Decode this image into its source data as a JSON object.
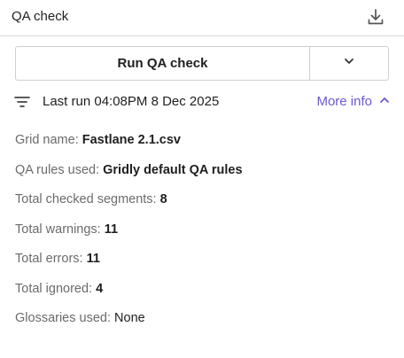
{
  "header": {
    "title": "QA check",
    "download_icon": "download-icon"
  },
  "actions": {
    "run_label": "Run QA check",
    "dropdown_icon": "chevron-down-icon"
  },
  "status": {
    "filter_icon": "filter-icon",
    "last_run": "Last run 04:08PM 8 Dec 2025",
    "more_info_label": "More info",
    "more_info_icon": "chevron-up-icon",
    "link_color": "#6a5acd"
  },
  "details": {
    "grid_name_label": "Grid name:",
    "grid_name_value": "Fastlane 2.1.csv",
    "qa_rules_label": "QA rules used:",
    "qa_rules_value": "Gridly default QA rules",
    "checked_segments_label": "Total checked segments:",
    "checked_segments_value": "8",
    "warnings_label": "Total warnings:",
    "warnings_value": "11",
    "errors_label": "Total errors:",
    "errors_value": "11",
    "ignored_label": "Total ignored:",
    "ignored_value": "4",
    "glossaries_label": "Glossaries used:",
    "glossaries_value": "None"
  }
}
